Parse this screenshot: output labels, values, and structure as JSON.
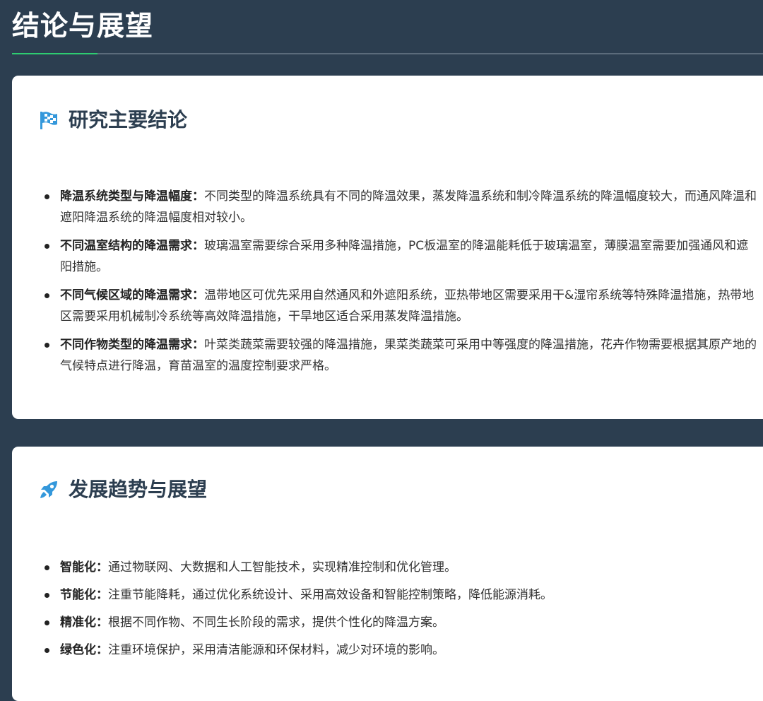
{
  "page": {
    "title": "结论与展望",
    "accent_color": "#2ecc71",
    "background_color": "#2c3e50"
  },
  "sections": [
    {
      "heading": "研究主要结论",
      "icon": "checkered-flag-icon",
      "icon_color": "#3498db",
      "items": [
        {
          "label": "降温系统类型与降温幅度：",
          "text": "不同类型的降温系统具有不同的降温效果，蒸发降温系统和制冷降温系统的降温幅度较大，而通风降温和遮阳降温系统的降温幅度相对较小。"
        },
        {
          "label": "不同温室结构的降温需求：",
          "text": "玻璃温室需要综合采用多种降温措施，PC板温室的降温能耗低于玻璃温室，薄膜温室需要加强通风和遮阳措施。"
        },
        {
          "label": "不同气候区域的降温需求：",
          "text": "温带地区可优先采用自然通风和外遮阳系统，亚热带地区需要采用干&湿帘系统等特殊降温措施，热带地区需要采用机械制冷系统等高效降温措施，干旱地区适合采用蒸发降温措施。"
        },
        {
          "label": "不同作物类型的降温需求：",
          "text": "叶菜类蔬菜需要较强的降温措施，果菜类蔬菜可采用中等强度的降温措施，花卉作物需要根据其原产地的气候特点进行降温，育苗温室的温度控制要求严格。"
        }
      ]
    },
    {
      "heading": "发展趋势与展望",
      "icon": "rocket-icon",
      "icon_color": "#3498db",
      "items": [
        {
          "label": "智能化：",
          "text": "通过物联网、大数据和人工智能技术，实现精准控制和优化管理。"
        },
        {
          "label": "节能化：",
          "text": "注重节能降耗，通过优化系统设计、采用高效设备和智能控制策略，降低能源消耗。"
        },
        {
          "label": "精准化：",
          "text": "根据不同作物、不同生长阶段的需求，提供个性化的降温方案。"
        },
        {
          "label": "绿色化：",
          "text": "注重环境保护，采用清洁能源和环保材料，减少对环境的影响。"
        }
      ]
    }
  ]
}
